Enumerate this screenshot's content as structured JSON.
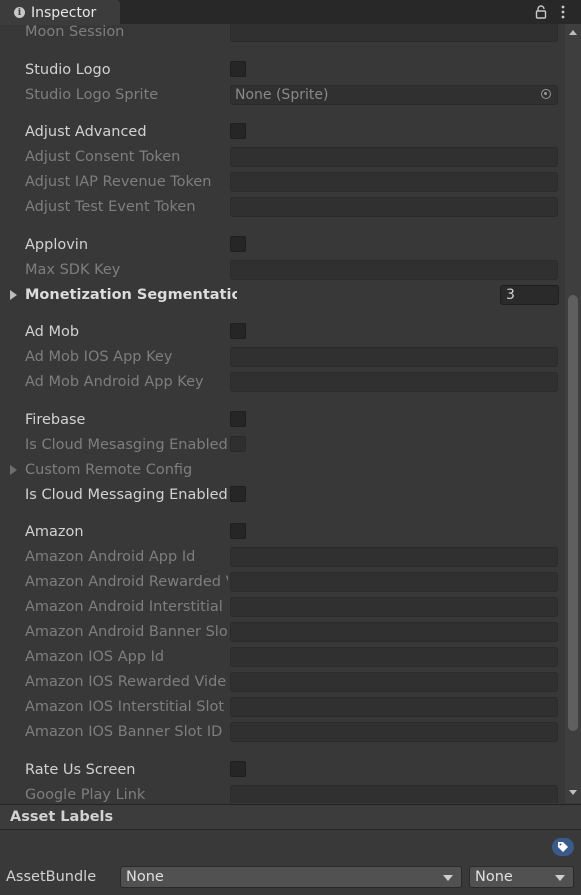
{
  "tab": {
    "title": "Inspector"
  },
  "rows": [
    {
      "label": "Moon Session",
      "type": "text",
      "value": "",
      "state": "disabled"
    },
    {
      "label": "Studio Logo",
      "type": "checkbox",
      "checked": false,
      "state": "enabled"
    },
    {
      "label": "Studio Logo Sprite",
      "type": "object",
      "value": "None (Sprite)",
      "state": "disabled"
    },
    {
      "label": "Adjust Advanced",
      "type": "checkbox",
      "checked": false,
      "state": "enabled"
    },
    {
      "label": "Adjust Consent Token",
      "type": "text",
      "value": "",
      "state": "disabled"
    },
    {
      "label": "Adjust IAP Revenue Token",
      "type": "text",
      "value": "",
      "state": "disabled"
    },
    {
      "label": "Adjust Test Event Token",
      "type": "text",
      "value": "",
      "state": "disabled"
    },
    {
      "label": "Applovin",
      "type": "checkbox",
      "checked": false,
      "state": "enabled"
    },
    {
      "label": "Max SDK Key",
      "type": "text",
      "value": "",
      "state": "disabled"
    },
    {
      "label": "Monetization Segmentation",
      "type": "foldout-int",
      "value": "3",
      "state": "enabled"
    },
    {
      "label": "Ad Mob",
      "type": "checkbox",
      "checked": false,
      "state": "enabled"
    },
    {
      "label": "Ad Mob IOS App Key",
      "type": "text",
      "value": "",
      "state": "disabled"
    },
    {
      "label": "Ad Mob Android App Key",
      "type": "text",
      "value": "",
      "state": "disabled"
    },
    {
      "label": "Firebase",
      "type": "checkbox",
      "checked": false,
      "state": "enabled"
    },
    {
      "label": "Is Cloud Mesasging Enabled",
      "type": "checkbox",
      "checked": false,
      "state": "disabled"
    },
    {
      "label": "Custom Remote Config",
      "type": "foldout",
      "state": "disabled"
    },
    {
      "label": "Is Cloud Messaging Enabled",
      "type": "checkbox",
      "checked": false,
      "state": "enabled"
    },
    {
      "label": "Amazon",
      "type": "checkbox",
      "checked": false,
      "state": "enabled"
    },
    {
      "label": "Amazon Android App Id",
      "type": "text",
      "value": "",
      "state": "disabled"
    },
    {
      "label": "Amazon Android Rewarded V",
      "type": "text",
      "value": "",
      "state": "disabled"
    },
    {
      "label": "Amazon Android Interstitial S",
      "type": "text",
      "value": "",
      "state": "disabled"
    },
    {
      "label": "Amazon Android Banner Slot",
      "type": "text",
      "value": "",
      "state": "disabled"
    },
    {
      "label": "Amazon IOS App Id",
      "type": "text",
      "value": "",
      "state": "disabled"
    },
    {
      "label": "Amazon IOS Rewarded Vide",
      "type": "text",
      "value": "",
      "state": "disabled"
    },
    {
      "label": "Amazon IOS Interstitial Slot I",
      "type": "text",
      "value": "",
      "state": "disabled"
    },
    {
      "label": "Amazon IOS Banner Slot ID",
      "type": "text",
      "value": "",
      "state": "disabled"
    },
    {
      "label": "Rate Us Screen",
      "type": "checkbox",
      "checked": false,
      "state": "enabled"
    },
    {
      "label": "Google Play Link",
      "type": "text",
      "value": "",
      "state": "disabled"
    }
  ],
  "asset_labels": {
    "title": "Asset Labels",
    "assetbundle_label": "AssetBundle",
    "bundle_name": "None",
    "bundle_variant": "None"
  },
  "icons": {
    "info": "info-icon",
    "lock": "lock-icon",
    "menu": "kebab-menu-icon",
    "object_picker": "object-picker-icon",
    "tag": "tag-icon"
  },
  "colors": {
    "background": "#383838",
    "tab_bar": "#282828",
    "field_bg": "#2a2a2a",
    "tag_button": "#3a5a8c"
  }
}
